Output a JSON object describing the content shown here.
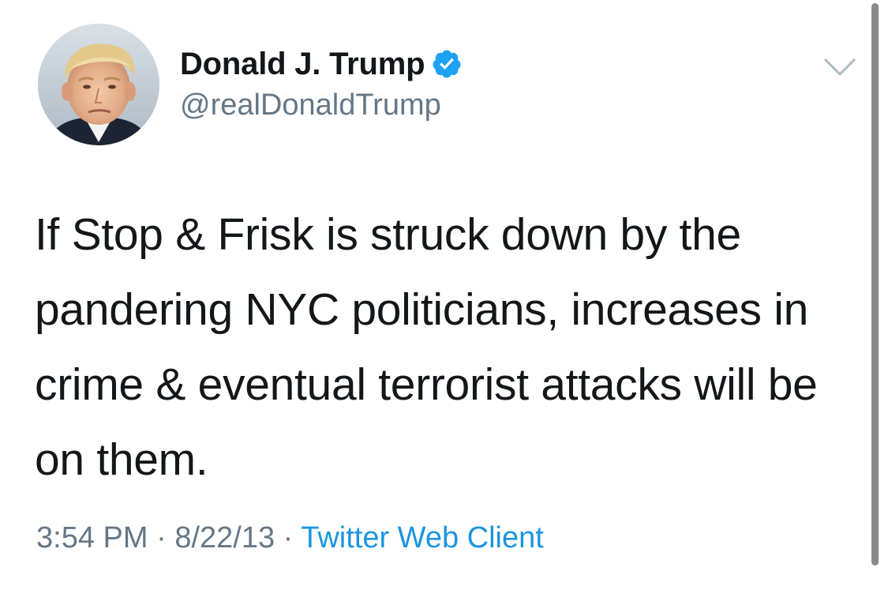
{
  "tweet": {
    "author": {
      "display_name": "Donald J. Trump",
      "handle": "@realDonaldTrump",
      "verified": true,
      "avatar_icon": "profile-photo",
      "verified_icon": "verified-badge-icon"
    },
    "menu_icon": "chevron-down-icon",
    "text": "If Stop & Frisk is struck down by the pandering NYC politicians, increases in crime & eventual terrorist attacks will be on them.",
    "time": "3:54 PM",
    "date": "8/22/13",
    "separator": " · ",
    "source": "Twitter Web Client"
  },
  "colors": {
    "text_primary": "#14171a",
    "text_secondary": "#657786",
    "link": "#1b95e0",
    "verified_badge": "#1da1f2",
    "background": "#ffffff"
  }
}
